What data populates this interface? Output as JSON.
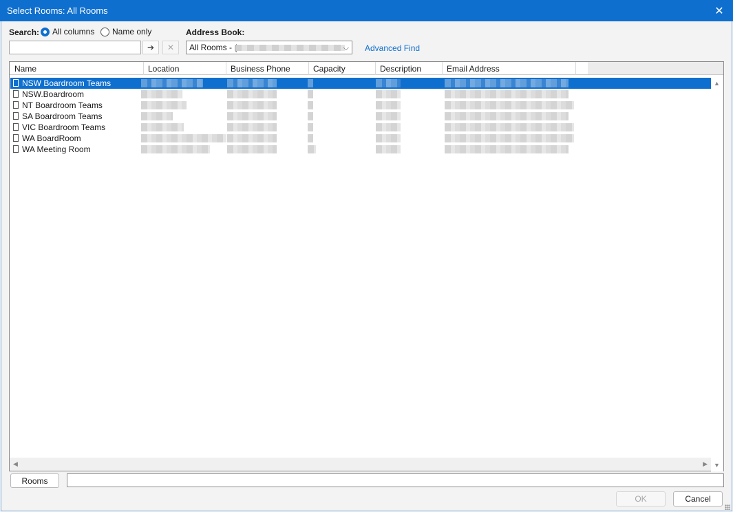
{
  "window": {
    "title": "Select Rooms: All Rooms",
    "close_glyph": "✕"
  },
  "search": {
    "label": "Search:",
    "options": [
      {
        "label": "All columns",
        "selected": true
      },
      {
        "label": "Name only",
        "selected": false
      }
    ],
    "value": "",
    "go_glyph": "➔",
    "clear_glyph": "✕"
  },
  "address_book": {
    "label": "Address Book:",
    "selected": "All Rooms - (",
    "advanced_find": "Advanced Find"
  },
  "table": {
    "columns": [
      "Name",
      "Location",
      "Business Phone",
      "Capacity",
      "Description",
      "Email Address"
    ],
    "rows": [
      {
        "name": "NSW Boardroom Teams",
        "selected": true
      },
      {
        "name": "NSW.Boardroom",
        "selected": false
      },
      {
        "name": "NT Boardroom Teams",
        "selected": false
      },
      {
        "name": "SA Boardroom Teams",
        "selected": false
      },
      {
        "name": "VIC Boardroom Teams",
        "selected": false
      },
      {
        "name": "WA BoardRoom",
        "selected": false
      },
      {
        "name": "WA Meeting Room",
        "selected": false
      }
    ]
  },
  "footer": {
    "rooms_button": "Rooms",
    "rooms_value": "",
    "ok_button": "OK",
    "cancel_button": "Cancel"
  },
  "colors": {
    "accent": "#0f6fce",
    "selection": "#0f6fce",
    "link": "#0f6fce"
  }
}
